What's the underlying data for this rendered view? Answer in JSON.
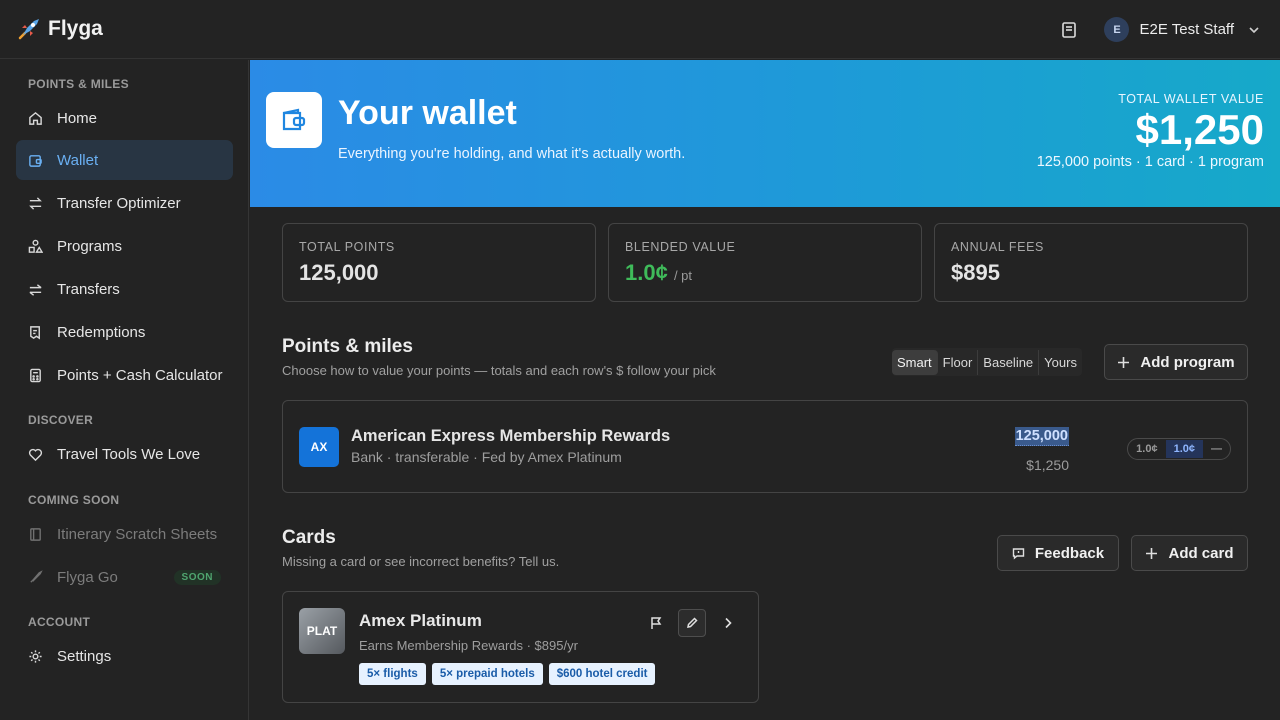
{
  "app": {
    "name": "Flyga"
  },
  "user": {
    "initial": "E",
    "name": "E2E Test Staff"
  },
  "sidebar": {
    "sections": [
      {
        "title": "POINTS & MILES"
      },
      {
        "title": "DISCOVER"
      },
      {
        "title": "COMING SOON"
      },
      {
        "title": "ACCOUNT"
      }
    ],
    "items": [
      {
        "label": "Home",
        "icon": "home-icon"
      },
      {
        "label": "Wallet",
        "icon": "wallet-icon",
        "active": true
      },
      {
        "label": "Transfer Optimizer",
        "icon": "arrows-swap-icon"
      },
      {
        "label": "Programs",
        "icon": "shapes-icon"
      },
      {
        "label": "Transfers",
        "icon": "transfer-icon"
      },
      {
        "label": "Redemptions",
        "icon": "receipt-icon"
      },
      {
        "label": "Points + Cash Calculator",
        "icon": "calculator-icon"
      },
      {
        "label": "Travel Tools We Love",
        "icon": "heart-icon"
      },
      {
        "label": "Itinerary Scratch Sheets",
        "icon": "notebook-icon",
        "disabled": true
      },
      {
        "label": "Flyga Go",
        "icon": "rocket-icon",
        "disabled": true,
        "badge": "SOON"
      },
      {
        "label": "Settings",
        "icon": "gear-icon"
      }
    ]
  },
  "hero": {
    "title": "Your wallet",
    "subtitle": "Everything you're holding, and what it's actually worth.",
    "total_label": "TOTAL WALLET VALUE",
    "total_value": "$1,250",
    "meta": "125,000 points · 1 card · 1 program"
  },
  "stats": [
    {
      "label": "TOTAL POINTS",
      "value": "125,000"
    },
    {
      "label": "BLENDED VALUE",
      "value": "1.0¢",
      "unit": "/ pt"
    },
    {
      "label": "ANNUAL FEES",
      "value": "$895"
    }
  ],
  "points_section": {
    "title": "Points & miles",
    "subtitle": "Choose how to value your points — totals and each row's $ follow your pick",
    "valuation_options": [
      "Smart",
      "Floor",
      "Baseline",
      "Yours"
    ],
    "selected_option": "Smart",
    "add_label": "Add program"
  },
  "programs": [
    {
      "logo": "AX",
      "name": "American Express Membership Rewards",
      "meta": "Bank · transferable · Fed by Amex Platinum",
      "points": "125,000",
      "value": "$1,250",
      "rates": [
        "1.0¢",
        "1.0¢",
        "—"
      ]
    }
  ],
  "cards_section": {
    "title": "Cards",
    "subtitle": "Missing a card or see incorrect benefits? Tell us.",
    "feedback_label": "Feedback",
    "add_label": "Add card"
  },
  "cards": [
    {
      "logo": "PLAT",
      "name": "Amex Platinum",
      "meta": "Earns Membership Rewards · $895/yr",
      "tags": [
        "5× flights",
        "5× prepaid hotels",
        "$600 hotel credit"
      ]
    }
  ],
  "colors": {
    "accent": "#2b8be6",
    "green": "#3fbb5a",
    "amex_blue": "#1473d9"
  }
}
